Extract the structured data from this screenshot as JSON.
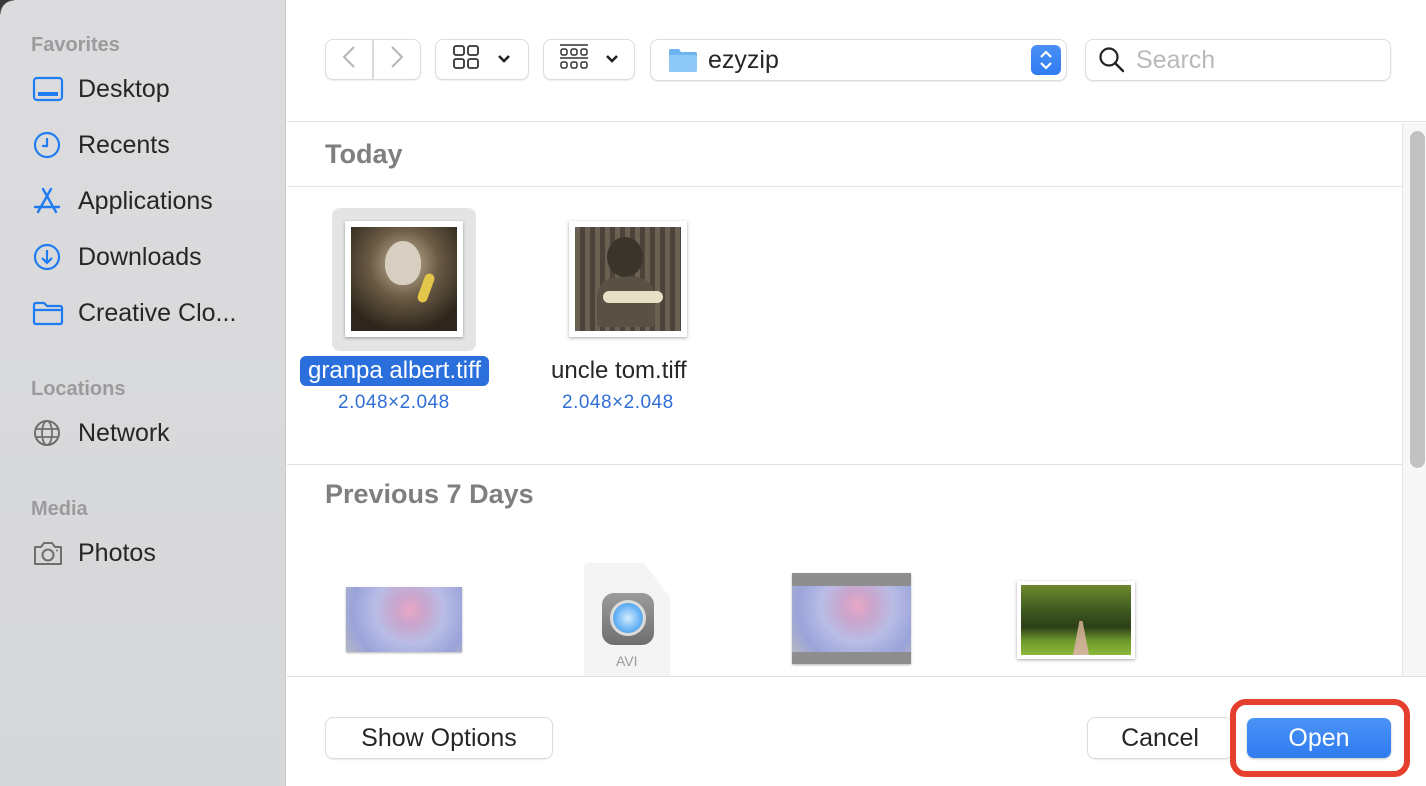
{
  "sidebar": {
    "sections": [
      {
        "title": "Favorites",
        "items": [
          {
            "label": "Desktop",
            "icon": "desktop-icon"
          },
          {
            "label": "Recents",
            "icon": "clock-icon"
          },
          {
            "label": "Applications",
            "icon": "applications-icon"
          },
          {
            "label": "Downloads",
            "icon": "download-icon"
          },
          {
            "label": "Creative Clo...",
            "icon": "folder-icon"
          }
        ]
      },
      {
        "title": "Locations",
        "items": [
          {
            "label": "Network",
            "icon": "globe-icon"
          }
        ]
      },
      {
        "title": "Media",
        "items": [
          {
            "label": "Photos",
            "icon": "camera-icon"
          }
        ]
      }
    ]
  },
  "toolbar": {
    "back": "back-icon",
    "forward": "forward-icon",
    "view_mode": "icon-grid-view",
    "group_mode": "group-by",
    "current_folder": "ezyzip",
    "search_placeholder": "Search",
    "search_value": ""
  },
  "content": {
    "groups": [
      {
        "title": "Today",
        "files": [
          {
            "name": "granpa albert.tiff",
            "dimensions": "2.048×2.048",
            "selected": true
          },
          {
            "name": "uncle tom.tiff",
            "dimensions": "2.048×2.048",
            "selected": false
          }
        ]
      },
      {
        "title": "Previous 7 Days",
        "files": [
          {
            "name": "",
            "kind": "image-smoke"
          },
          {
            "name": "",
            "kind": "avi-video",
            "badge": "AVI"
          },
          {
            "name": "",
            "kind": "image-smoke-framed"
          },
          {
            "name": "",
            "kind": "image-park"
          }
        ]
      }
    ]
  },
  "footer": {
    "show_options": "Show Options",
    "cancel": "Cancel",
    "open": "Open"
  },
  "colors": {
    "accent": "#2f7bf0",
    "selection": "#2a6fdc",
    "highlight_ring": "#e5402d",
    "sidebar_icon": "#1f7cf3"
  }
}
